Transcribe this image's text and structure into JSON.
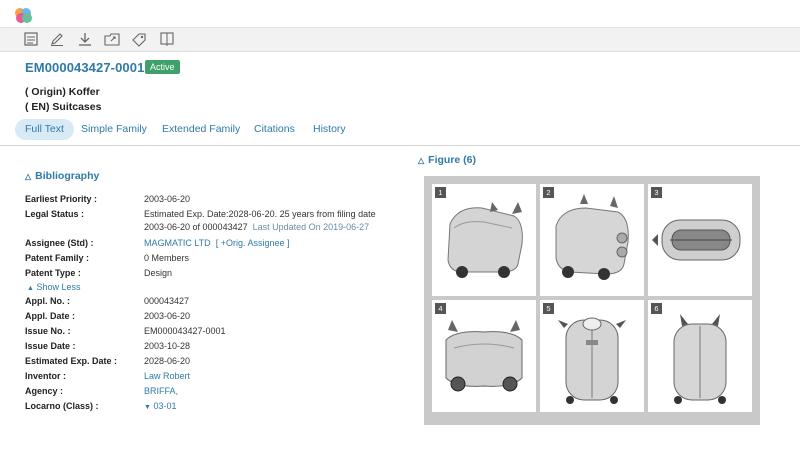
{
  "app": {
    "logo": "app-logo"
  },
  "toolbar": {
    "icons": [
      "document-icon",
      "edit-icon",
      "download-icon",
      "folder-export-icon",
      "tag-icon",
      "book-icon"
    ]
  },
  "document": {
    "id": "EM000043427-0001",
    "status": "Active",
    "title_origin": "( Origin) Koffer",
    "title_en": "( EN) Suitcases"
  },
  "tabs": [
    "Full Text",
    "Simple Family",
    "Extended Family",
    "Citations",
    "History"
  ],
  "bibliography": {
    "heading": "Bibliography",
    "earliest_priority_label": "Earliest Priority :",
    "earliest_priority": "2003-06-20",
    "legal_status_label": "Legal Status :",
    "legal_status_line1": "Estimated Exp. Date:2028-06-20. 25 years from filing date",
    "legal_status_line2_main": "2003-06-20 of 000043427",
    "legal_status_line2_updated": "Last Updated On 2019-06-27",
    "assignee_label": "Assignee (Std) :",
    "assignee": "MAGMATIC LTD",
    "orig_assignee": "[ +Orig. Assignee ]",
    "patent_family_label": "Patent Family :",
    "patent_family": "0 Members",
    "patent_type_label": "Patent Type :",
    "patent_type": "Design",
    "show_less": "Show Less",
    "appl_no_label": "Appl. No. :",
    "appl_no": "000043427",
    "appl_date_label": "Appl. Date :",
    "appl_date": "2003-06-20",
    "issue_no_label": "Issue No. :",
    "issue_no": "EM000043427-0001",
    "issue_date_label": "Issue Date :",
    "issue_date": "2003-10-28",
    "est_exp_label": "Estimated Exp. Date :",
    "est_exp": "2028-06-20",
    "inventor_label": "Inventor :",
    "inventor": "Law Robert",
    "agency_label": "Agency :",
    "agency": "BRIFFA,",
    "locarno_label": "Locarno (Class) :",
    "locarno": "03-01"
  },
  "figures": {
    "heading": "Figure (6)",
    "numbers": [
      "1",
      "2",
      "3",
      "4",
      "5",
      "6"
    ]
  },
  "colors": {
    "accent": "#2f7aa8",
    "active_badge": "#3ea16b"
  }
}
